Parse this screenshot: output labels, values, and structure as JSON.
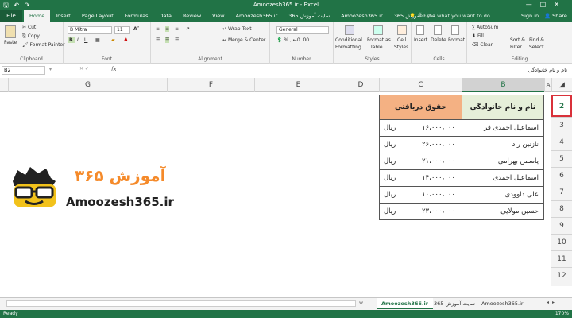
{
  "window": {
    "title": "Amoozesh365.ir - Excel"
  },
  "ribbon_tabs": {
    "file": "File",
    "tabs": [
      "Home",
      "Insert",
      "Page Layout",
      "Formulas",
      "Data",
      "Review",
      "View",
      "Amoozesh365.ir",
      "سایت آموزش 365",
      "Amoozesh365.ir",
      "سایت آموزش 365"
    ],
    "tell_me": "Tell me what you want to do...",
    "sign_in": "Sign in",
    "share": "Share"
  },
  "ribbon": {
    "clipboard": {
      "paste": "Paste",
      "cut": "Cut",
      "copy": "Copy",
      "format_painter": "Format Painter",
      "label": "Clipboard"
    },
    "font": {
      "name": "B Mitra",
      "size": "11",
      "label": "Font"
    },
    "alignment": {
      "wrap": "Wrap Text",
      "merge": "Merge & Center",
      "label": "Alignment"
    },
    "number": {
      "format": "General",
      "label": "Number"
    },
    "styles": {
      "conditional": "Conditional",
      "formatting": "Formatting",
      "format_as": "Format as",
      "table": "Table",
      "cell": "Cell",
      "cell_styles": "Styles",
      "label": "Styles"
    },
    "cells": {
      "insert": "Insert",
      "delete": "Delete",
      "format": "Format",
      "label": "Cells"
    },
    "editing": {
      "autosum": "AutoSum",
      "fill": "Fill",
      "clear": "Clear",
      "sort": "Sort &",
      "filter": "Filter",
      "find": "Find &",
      "select": "Select",
      "label": "Editing"
    }
  },
  "formula_bar": {
    "name_box": "B2",
    "fx": "fx",
    "content": "نام و نام خانوادگی"
  },
  "columns": [
    "G",
    "F",
    "E",
    "D",
    "C",
    "B",
    "A"
  ],
  "rows": [
    "2",
    "3",
    "4",
    "5",
    "6",
    "7",
    "8",
    "9",
    "10",
    "11",
    "12"
  ],
  "table": {
    "headers": {
      "name": "نام و نام خانوادگی",
      "salary": "حقوق دریافتی"
    },
    "records": [
      {
        "name": "اسماعیل احمدی فر",
        "amount": "۱۶،۰۰۰،۰۰۰",
        "currency": "ریال"
      },
      {
        "name": "نازنین راد",
        "amount": "۲۶،۰۰۰،۰۰۰",
        "currency": "ریال"
      },
      {
        "name": "یاسمن بهرامی",
        "amount": "۲۱،۰۰۰،۰۰۰",
        "currency": "ریال"
      },
      {
        "name": "اسماعیل احمدی",
        "amount": "۱۴،۰۰۰،۰۰۰",
        "currency": "ریال"
      },
      {
        "name": "علی داوودی",
        "amount": "۱۰،۰۰۰،۰۰۰",
        "currency": "ریال"
      },
      {
        "name": "حسین مولایی",
        "amount": "۲۳،۰۰۰،۰۰۰",
        "currency": "ریال"
      }
    ]
  },
  "logo": {
    "brand": "Amoozesh365.ir",
    "brand_fa": "آموزش ۳۶۵"
  },
  "sheets": [
    "Amoozesh365.ir",
    "سایت آموزش 365",
    "Amoozesh365.ir"
  ],
  "status": {
    "ready": "Ready",
    "zoom": "170%"
  },
  "colors": {
    "accent": "#217346",
    "header_fill": "#f4b183",
    "selection": "#d9313a"
  }
}
